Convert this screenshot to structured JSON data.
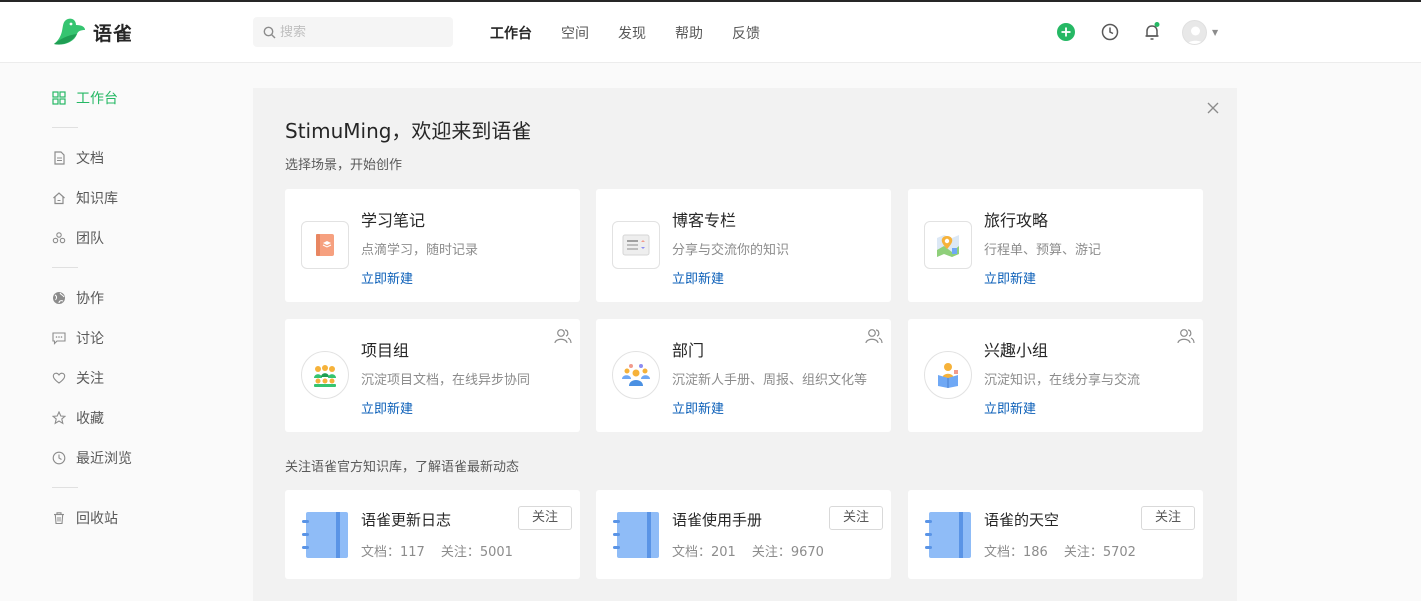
{
  "app": {
    "name": "语雀"
  },
  "search": {
    "placeholder": "搜索"
  },
  "nav": {
    "items": [
      "工作台",
      "空间",
      "发现",
      "帮助",
      "反馈"
    ]
  },
  "header_icons": [
    "plus-circle-icon",
    "clock-icon",
    "bell-icon",
    "avatar",
    "chevron-down-icon"
  ],
  "sidebar": {
    "items": [
      "工作台",
      "文档",
      "知识库",
      "团队",
      "协作",
      "讨论",
      "关注",
      "收藏",
      "最近浏览",
      "回收站"
    ]
  },
  "main": {
    "welcome": "StimuMing，欢迎来到语雀",
    "subtitle": "选择场景，开始创作",
    "create_link": "立即新建",
    "scenes": [
      {
        "title": "学习笔记",
        "desc": "点滴学习，随时记录",
        "icon": "notebook-icon"
      },
      {
        "title": "博客专栏",
        "desc": "分享与交流你的知识",
        "icon": "blog-icon"
      },
      {
        "title": "旅行攻略",
        "desc": "行程单、预算、游记",
        "icon": "map-pin-icon"
      },
      {
        "title": "项目组",
        "desc": "沉淀项目文档，在线异步协同",
        "icon": "project-team-icon"
      },
      {
        "title": "部门",
        "desc": "沉淀新人手册、周报、组织文化等",
        "icon": "department-icon"
      },
      {
        "title": "兴趣小组",
        "desc": "沉淀知识，在线分享与交流",
        "icon": "interest-group-icon"
      }
    ],
    "follow_title": "关注语雀官方知识库，了解语雀最新动态",
    "follow_button": "关注",
    "repos": [
      {
        "title": "语雀更新日志",
        "docs_label": "文档：",
        "docs": "117",
        "follows_label": "关注：",
        "follows": "5001"
      },
      {
        "title": "语雀使用手册",
        "docs_label": "文档：",
        "docs": "201",
        "follows_label": "关注：",
        "follows": "9670"
      },
      {
        "title": "语雀的天空",
        "docs_label": "文档：",
        "docs": "186",
        "follows_label": "关注：",
        "follows": "5702"
      }
    ]
  },
  "colors": {
    "brand": "#25b864",
    "link": "#0b5fb8",
    "book": "#6fa8f5"
  }
}
